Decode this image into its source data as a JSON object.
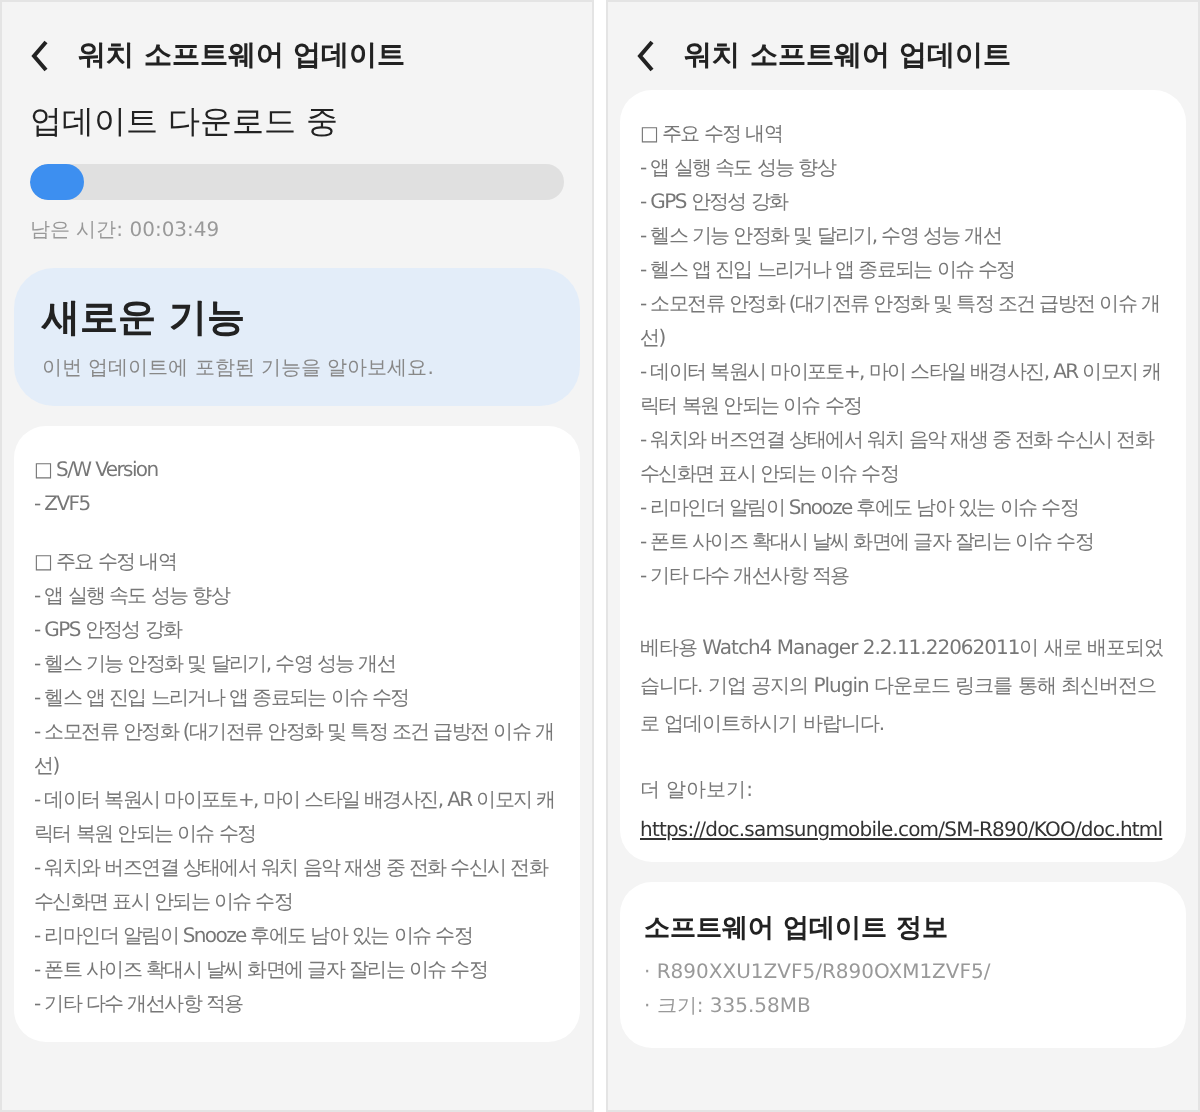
{
  "screens": [
    {
      "title": "워치 소프트웨어 업데이트",
      "blocks": [
        {
          "kind": "download",
          "heading": "업데이트 다운로드 중",
          "level": 0.1,
          "remaining": "남은 시간: 00:03:49"
        },
        {
          "kind": "feature",
          "title": "새로운 기능",
          "subtitle": "이번 업데이트에 포함된 기능을 알아보세요."
        },
        {
          "kind": "notes",
          "groups": [
            {
              "heading": "□ S/W Version",
              "items": [
                "- ZVF5"
              ]
            },
            {
              "heading": "□ 주요 수정 내역",
              "items": [
                "- 앱 실행 속도 성능 향상",
                "- GPS 안정성 강화",
                "- 헬스 기능 안정화 및 달리기, 수영 성능 개선",
                "- 헬스 앱 진입 느리거나 앱 종료되는 이슈 수정",
                "- 소모전류 안정화 (대기전류 안정화 및 특정 조건 급방전 이슈 개선)",
                "- 데이터 복원시 마이포토+, 마이 스타일 배경사진, AR 이모지 캐릭터 복원 안되는 이슈 수정",
                "- 워치와 버즈연결 상태에서 워치 음악 재생 중 전화 수신시 전화 수신화면 표시 안되는 이슈 수정",
                "- 리마인더 알림이 Snooze 후에도 남아 있는 이슈 수정",
                "- 폰트 사이즈 확대시 날씨 화면에 글자 잘리는 이슈 수정",
                "- 기타 다수 개선사항 적용"
              ]
            }
          ]
        }
      ]
    },
    {
      "title": "워치 소프트웨어 업데이트",
      "blocks": [
        {
          "kind": "notes",
          "groups": [
            {
              "heading": "□ 주요 수정 내역",
              "items": [
                "- 앱 실행 속도 성능 향상",
                "- GPS 안정성 강화",
                "- 헬스 기능 안정화 및 달리기, 수영 성능 개선",
                "- 헬스 앱 진입 느리거나 앱 종료되는 이슈 수정",
                "- 소모전류 안정화 (대기전류 안정화 및 특정 조건 급방전 이슈 개선)",
                "- 데이터 복원시 마이포토+, 마이 스타일 배경사진, AR 이모지 캐릭터 복원 안되는 이슈 수정",
                "- 워치와 버즈연결 상태에서 워치 음악 재생 중 전화 수신시 전화 수신화면 표시 안되는 이슈 수정",
                "- 리마인더 알림이 Snooze 후에도 남아 있는 이슈 수정",
                "- 폰트 사이즈 확대시 날씨 화면에 글자 잘리는 이슈 수정",
                "- 기타 다수 개선사항 적용"
              ]
            }
          ],
          "paragraph": "베타용 Watch4 Manager 2.2.11.22062011이 새로 배포되었습니다. 기업 공지의 Plugin 다운로드 링크를 통해 최신버전으로 업데이트하시기 바랍니다.",
          "more": "더 알아보기:",
          "link": "https://doc.samsungmobile.com/SM-R890/KOO/doc.html"
        },
        {
          "kind": "info",
          "title": "소프트웨어 업데이트 정보",
          "lines": [
            "· R890XXU1ZVF5/R890OXM1ZVF5/",
            "· 크기: 335.58MB"
          ]
        }
      ]
    }
  ]
}
